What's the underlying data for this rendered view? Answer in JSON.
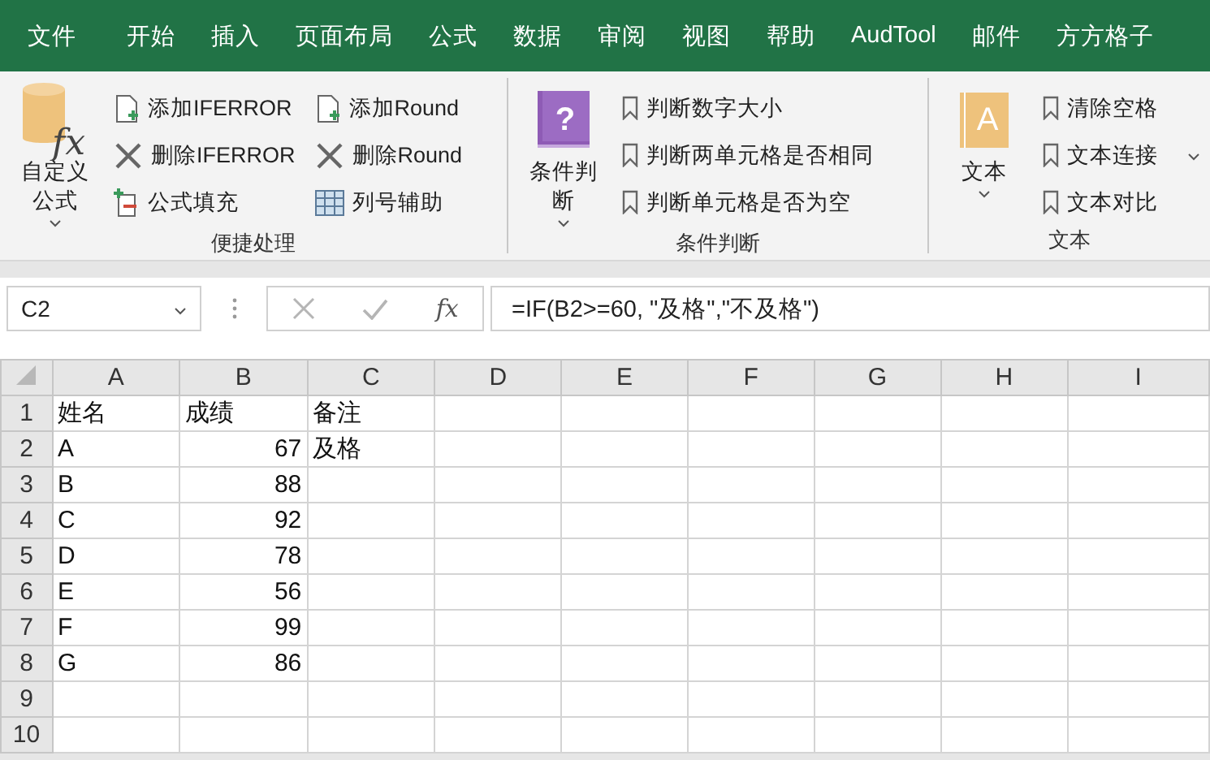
{
  "menu_tabs": [
    "文件",
    "开始",
    "插入",
    "页面布局",
    "公式",
    "数据",
    "审阅",
    "视图",
    "帮助",
    "AudTool",
    "邮件",
    "方方格子"
  ],
  "ribbon": {
    "groups": [
      {
        "label": "便捷处理",
        "large_button": {
          "label": "自定义公式",
          "kind": "formula",
          "icon_text": "fx",
          "dropdown": true
        },
        "columns": [
          [
            {
              "label": "添加IFERROR",
              "kind": "doc-add"
            },
            {
              "label": "删除IFERROR",
              "kind": "cross"
            },
            {
              "label": "公式填充",
              "kind": "fill"
            }
          ],
          [
            {
              "label": "添加Round",
              "kind": "doc-add"
            },
            {
              "label": "删除Round",
              "kind": "cross"
            },
            {
              "label": "列号辅助",
              "kind": "grid"
            }
          ]
        ]
      },
      {
        "label": "条件判断",
        "large_button": {
          "label": "条件判断",
          "kind": "help-book",
          "icon_text": "?",
          "dropdown": true
        },
        "columns": [
          [
            {
              "label": "判断数字大小",
              "kind": "bookmark"
            },
            {
              "label": "判断两单元格是否相同",
              "kind": "bookmark"
            },
            {
              "label": "判断单元格是否为空",
              "kind": "bookmark"
            }
          ]
        ]
      },
      {
        "label": "文本",
        "large_button": {
          "label": "文本",
          "kind": "text-book",
          "icon_text": "A",
          "dropdown": true
        },
        "columns": [
          [
            {
              "label": "清除空格",
              "kind": "bookmark"
            },
            {
              "label": "文本连接",
              "kind": "bookmark"
            },
            {
              "label": "文本对比",
              "kind": "bookmark"
            }
          ]
        ],
        "more": true
      }
    ]
  },
  "formula_bar": {
    "name_box": "C2",
    "function_label": "fx",
    "formula": "=IF(B2>=60, \"及格\",\"不及格\")"
  },
  "sheet": {
    "columns": [
      "A",
      "B",
      "C",
      "D",
      "E",
      "F",
      "G",
      "H",
      "I"
    ],
    "rows": [
      {
        "number": "1",
        "cells": [
          {
            "value": "姓名",
            "kind": "text"
          },
          {
            "value": "成绩",
            "kind": "text"
          },
          {
            "value": "备注",
            "kind": "text"
          }
        ]
      },
      {
        "number": "2",
        "cells": [
          {
            "value": "A",
            "kind": "text"
          },
          {
            "value": "67",
            "kind": "number"
          },
          {
            "value": "及格",
            "kind": "text"
          }
        ]
      },
      {
        "number": "3",
        "cells": [
          {
            "value": "B",
            "kind": "text"
          },
          {
            "value": "88",
            "kind": "number"
          }
        ]
      },
      {
        "number": "4",
        "cells": [
          {
            "value": "C",
            "kind": "text"
          },
          {
            "value": "92",
            "kind": "number"
          }
        ]
      },
      {
        "number": "5",
        "cells": [
          {
            "value": "D",
            "kind": "text"
          },
          {
            "value": "78",
            "kind": "number"
          }
        ]
      },
      {
        "number": "6",
        "cells": [
          {
            "value": "E",
            "kind": "text"
          },
          {
            "value": "56",
            "kind": "number"
          }
        ]
      },
      {
        "number": "7",
        "cells": [
          {
            "value": "F",
            "kind": "text"
          },
          {
            "value": "99",
            "kind": "number"
          }
        ]
      },
      {
        "number": "8",
        "cells": [
          {
            "value": "G",
            "kind": "text"
          },
          {
            "value": "86",
            "kind": "number"
          }
        ]
      },
      {
        "number": "9",
        "cells": []
      },
      {
        "number": "10",
        "cells": []
      }
    ]
  }
}
